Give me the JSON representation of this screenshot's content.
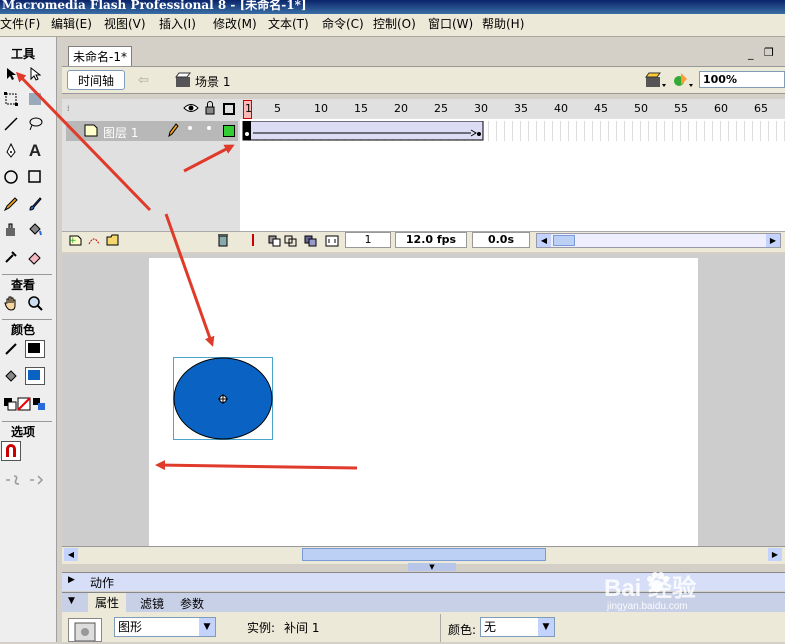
{
  "app": {
    "title": "Macromedia Flash Professional 8 - [未命名-1*]"
  },
  "menu": [
    "文件(F)",
    "编辑(E)",
    "视图(V)",
    "插入(I)",
    "修改(M)",
    "文本(T)",
    "命令(C)",
    "控制(O)",
    "窗口(W)",
    "帮助(H)"
  ],
  "tools": {
    "header": "工具",
    "view_header": "查看",
    "color_header": "颜色",
    "options_header": "选项",
    "text_tool_glyph": "A"
  },
  "document": {
    "tab": "未命名-1*",
    "timeline_button": "时间轴",
    "scene": "场景 1",
    "zoom": "100%"
  },
  "timeline": {
    "frame_numbers": [
      "1",
      "5",
      "10",
      "15",
      "20",
      "25",
      "30",
      "35",
      "40",
      "45",
      "50",
      "55",
      "60",
      "65"
    ],
    "layer_name": "图层 1",
    "current_frame": "1",
    "fps": "12.0 fps",
    "elapsed": "0.0s"
  },
  "panels": {
    "actions": "动作",
    "properties_tabs": [
      "属性",
      "滤镜",
      "参数"
    ],
    "instance_type": "图形",
    "instance_label": "实例:",
    "instance_value": "补间 1",
    "color_label": "颜色:",
    "color_value": "无"
  },
  "watermark": {
    "brand": "Bai  经验",
    "url": "jingyan.baidu.com"
  },
  "colors": {
    "ellipse_fill": "#0a63c2",
    "stroke_color": "#000000",
    "fill_swatch": "#0a63c2",
    "annotation_arrow": "#e03a2a",
    "keyframe_marker": "#cc0000",
    "layer_color": "#33cc33"
  }
}
